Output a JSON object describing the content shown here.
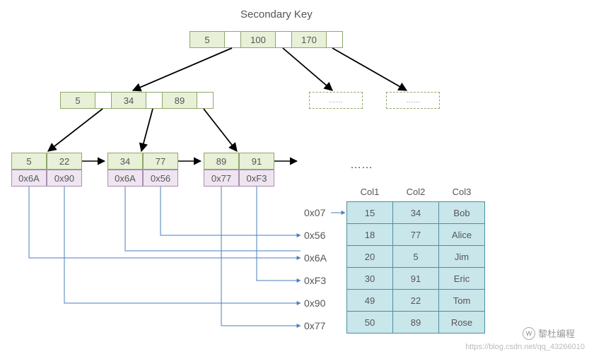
{
  "title": "Secondary Key",
  "root": {
    "keys": [
      "5",
      "100",
      "170"
    ]
  },
  "mid": {
    "keys": [
      "5",
      "34",
      "89"
    ]
  },
  "leaves": [
    {
      "keys": [
        "5",
        "22"
      ],
      "vals": [
        "0x6A",
        "0x90"
      ]
    },
    {
      "keys": [
        "34",
        "77"
      ],
      "vals": [
        "0x6A",
        "0x56"
      ]
    },
    {
      "keys": [
        "89",
        "91"
      ],
      "vals": [
        "0x77",
        "0xF3"
      ]
    }
  ],
  "dots": "……",
  "addrs": [
    "0x07",
    "0x56",
    "0x6A",
    "0xF3",
    "0x90",
    "0x77"
  ],
  "table": {
    "headers": [
      "Col1",
      "Col2",
      "Col3"
    ],
    "rows": [
      [
        "15",
        "34",
        "Bob"
      ],
      [
        "18",
        "77",
        "Alice"
      ],
      [
        "20",
        "5",
        "Jim"
      ],
      [
        "30",
        "91",
        "Eric"
      ],
      [
        "49",
        "22",
        "Tom"
      ],
      [
        "50",
        "89",
        "Rose"
      ]
    ]
  },
  "wm": {
    "brand": "黎杜编程",
    "url": "https://blog.csdn.net/qq_43266010"
  },
  "chart_data": {
    "type": "diagram",
    "structure": "B+ tree secondary index",
    "root_keys": [
      5,
      100,
      170
    ],
    "internal_keys": [
      5,
      34,
      89
    ],
    "leaf_nodes": [
      {
        "keys": [
          5,
          22
        ],
        "pointers": [
          "0x6A",
          "0x90"
        ]
      },
      {
        "keys": [
          34,
          77
        ],
        "pointers": [
          "0x6A",
          "0x56"
        ]
      },
      {
        "keys": [
          89,
          91
        ],
        "pointers": [
          "0x77",
          "0xF3"
        ]
      }
    ],
    "pointer_to_row": {
      "0x07": 0,
      "0x56": 1,
      "0x6A": 2,
      "0xF3": 3,
      "0x90": 4,
      "0x77": 5
    },
    "data_table": {
      "columns": [
        "Col1",
        "Col2",
        "Col3"
      ],
      "rows": [
        [
          15,
          34,
          "Bob"
        ],
        [
          18,
          77,
          "Alice"
        ],
        [
          20,
          5,
          "Jim"
        ],
        [
          30,
          91,
          "Eric"
        ],
        [
          49,
          22,
          "Tom"
        ],
        [
          50,
          89,
          "Rose"
        ]
      ]
    }
  }
}
